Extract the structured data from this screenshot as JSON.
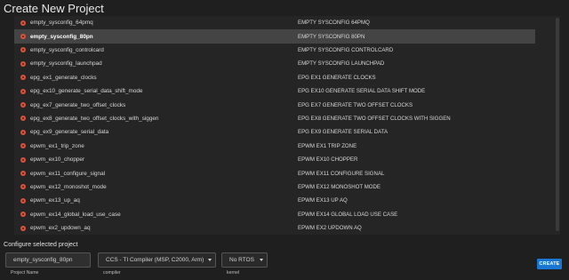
{
  "window": {
    "title_prefix": "Create",
    "title_suffix": "New Project"
  },
  "projects": [
    {
      "name": "empty_sysconfig_64pmq",
      "desc": "EMPTY SYSCONFIG 64PMQ",
      "selected": false
    },
    {
      "name": "empty_sysconfig_80pn",
      "desc": "EMPTY SYSCONFIG 80PN",
      "selected": true
    },
    {
      "name": "empty_sysconfig_controlcard",
      "desc": "EMPTY SYSCONFIG CONTROLCARD",
      "selected": false
    },
    {
      "name": "empty_sysconfig_launchpad",
      "desc": "EMPTY SYSCONFIG LAUNCHPAD",
      "selected": false
    },
    {
      "name": "epg_ex1_generate_clocks",
      "desc": "EPG EX1 GENERATE CLOCKS",
      "selected": false
    },
    {
      "name": "epg_ex10_generate_serial_data_shift_mode",
      "desc": "EPG EX10 GENERATE SERIAL DATA SHIFT MODE",
      "selected": false
    },
    {
      "name": "epg_ex7_generate_two_offset_clocks",
      "desc": "EPG EX7 GENERATE TWO OFFSET CLOCKS",
      "selected": false
    },
    {
      "name": "epg_ex8_generate_two_offset_clocks_with_siggen",
      "desc": "EPG EX8 GENERATE TWO OFFSET CLOCKS WITH SIGGEN",
      "selected": false
    },
    {
      "name": "epg_ex9_generate_serial_data",
      "desc": "EPG EX9 GENERATE SERIAL DATA",
      "selected": false
    },
    {
      "name": "epwm_ex1_trip_zone",
      "desc": "EPWM EX1 TRIP ZONE",
      "selected": false
    },
    {
      "name": "epwm_ex10_chopper",
      "desc": "EPWM EX10 CHOPPER",
      "selected": false
    },
    {
      "name": "epwm_ex11_configure_signal",
      "desc": "EPWM EX11 CONFIGURE SIGNAL",
      "selected": false
    },
    {
      "name": "epwm_ex12_monoshot_mode",
      "desc": "EPWM EX12 MONOSHOT MODE",
      "selected": false
    },
    {
      "name": "epwm_ex13_up_aq",
      "desc": "EPWM EX13 UP AQ",
      "selected": false
    },
    {
      "name": "epwm_ex14_global_load_use_case",
      "desc": "EPWM EX14 GLOBAL LOAD USE CASE",
      "selected": false
    },
    {
      "name": "epwm_ex2_updown_aq",
      "desc": "EPWM EX2 UPDOWN AQ",
      "selected": false
    }
  ],
  "configure": {
    "section_label": "Configure selected project",
    "project_name_value": "empty_sysconfig_80pn",
    "project_name_label": "Project Name",
    "compiler_value": "CCS - TI Compiler (MSP, C2000, Arm)",
    "compiler_label": "compiler",
    "kernel_value": "No RTOS",
    "kernel_label": "kernel",
    "create_label": "CREATE"
  },
  "icons": {
    "project_icon": "ti-project-icon",
    "dropdown_icon": "chevron-down-icon"
  },
  "colors": {
    "accent": "#1976d2",
    "icon": "#d9533d"
  }
}
